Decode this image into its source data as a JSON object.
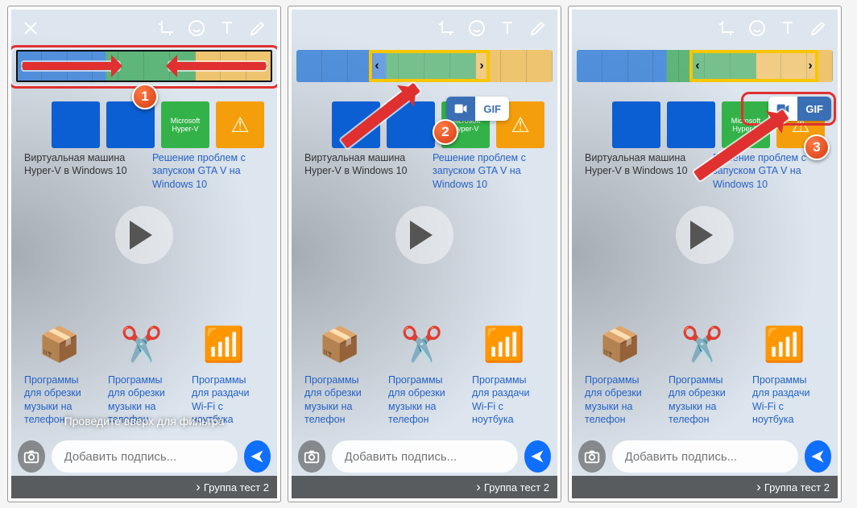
{
  "toolbar": {
    "close": "×",
    "icons": [
      "crop-rotate-icon",
      "emoji-icon",
      "text-icon",
      "draw-icon"
    ]
  },
  "step_labels": {
    "s1": "1",
    "s2": "2",
    "s3": "3"
  },
  "gif_toggle": {
    "video": "",
    "gif": "GIF"
  },
  "swipe_hint": "Проведите вверх для фильтра",
  "caption_placeholder": "Добавить подпись...",
  "recipient": "Группа тест 2",
  "bg": {
    "tile_microsoft": "Microsoft\nHyper-V",
    "art1": "Виртуальная машина Hyper-V в Windows 10",
    "art2": "Решение проблем с запуском GTA V на Windows 10",
    "art3a": "Программы для обрезки музыки на телефон",
    "art3b": "Программы для обрезки музыки на телефон",
    "art4": "Программы для раздачи Wi-Fi с ноутбука"
  }
}
